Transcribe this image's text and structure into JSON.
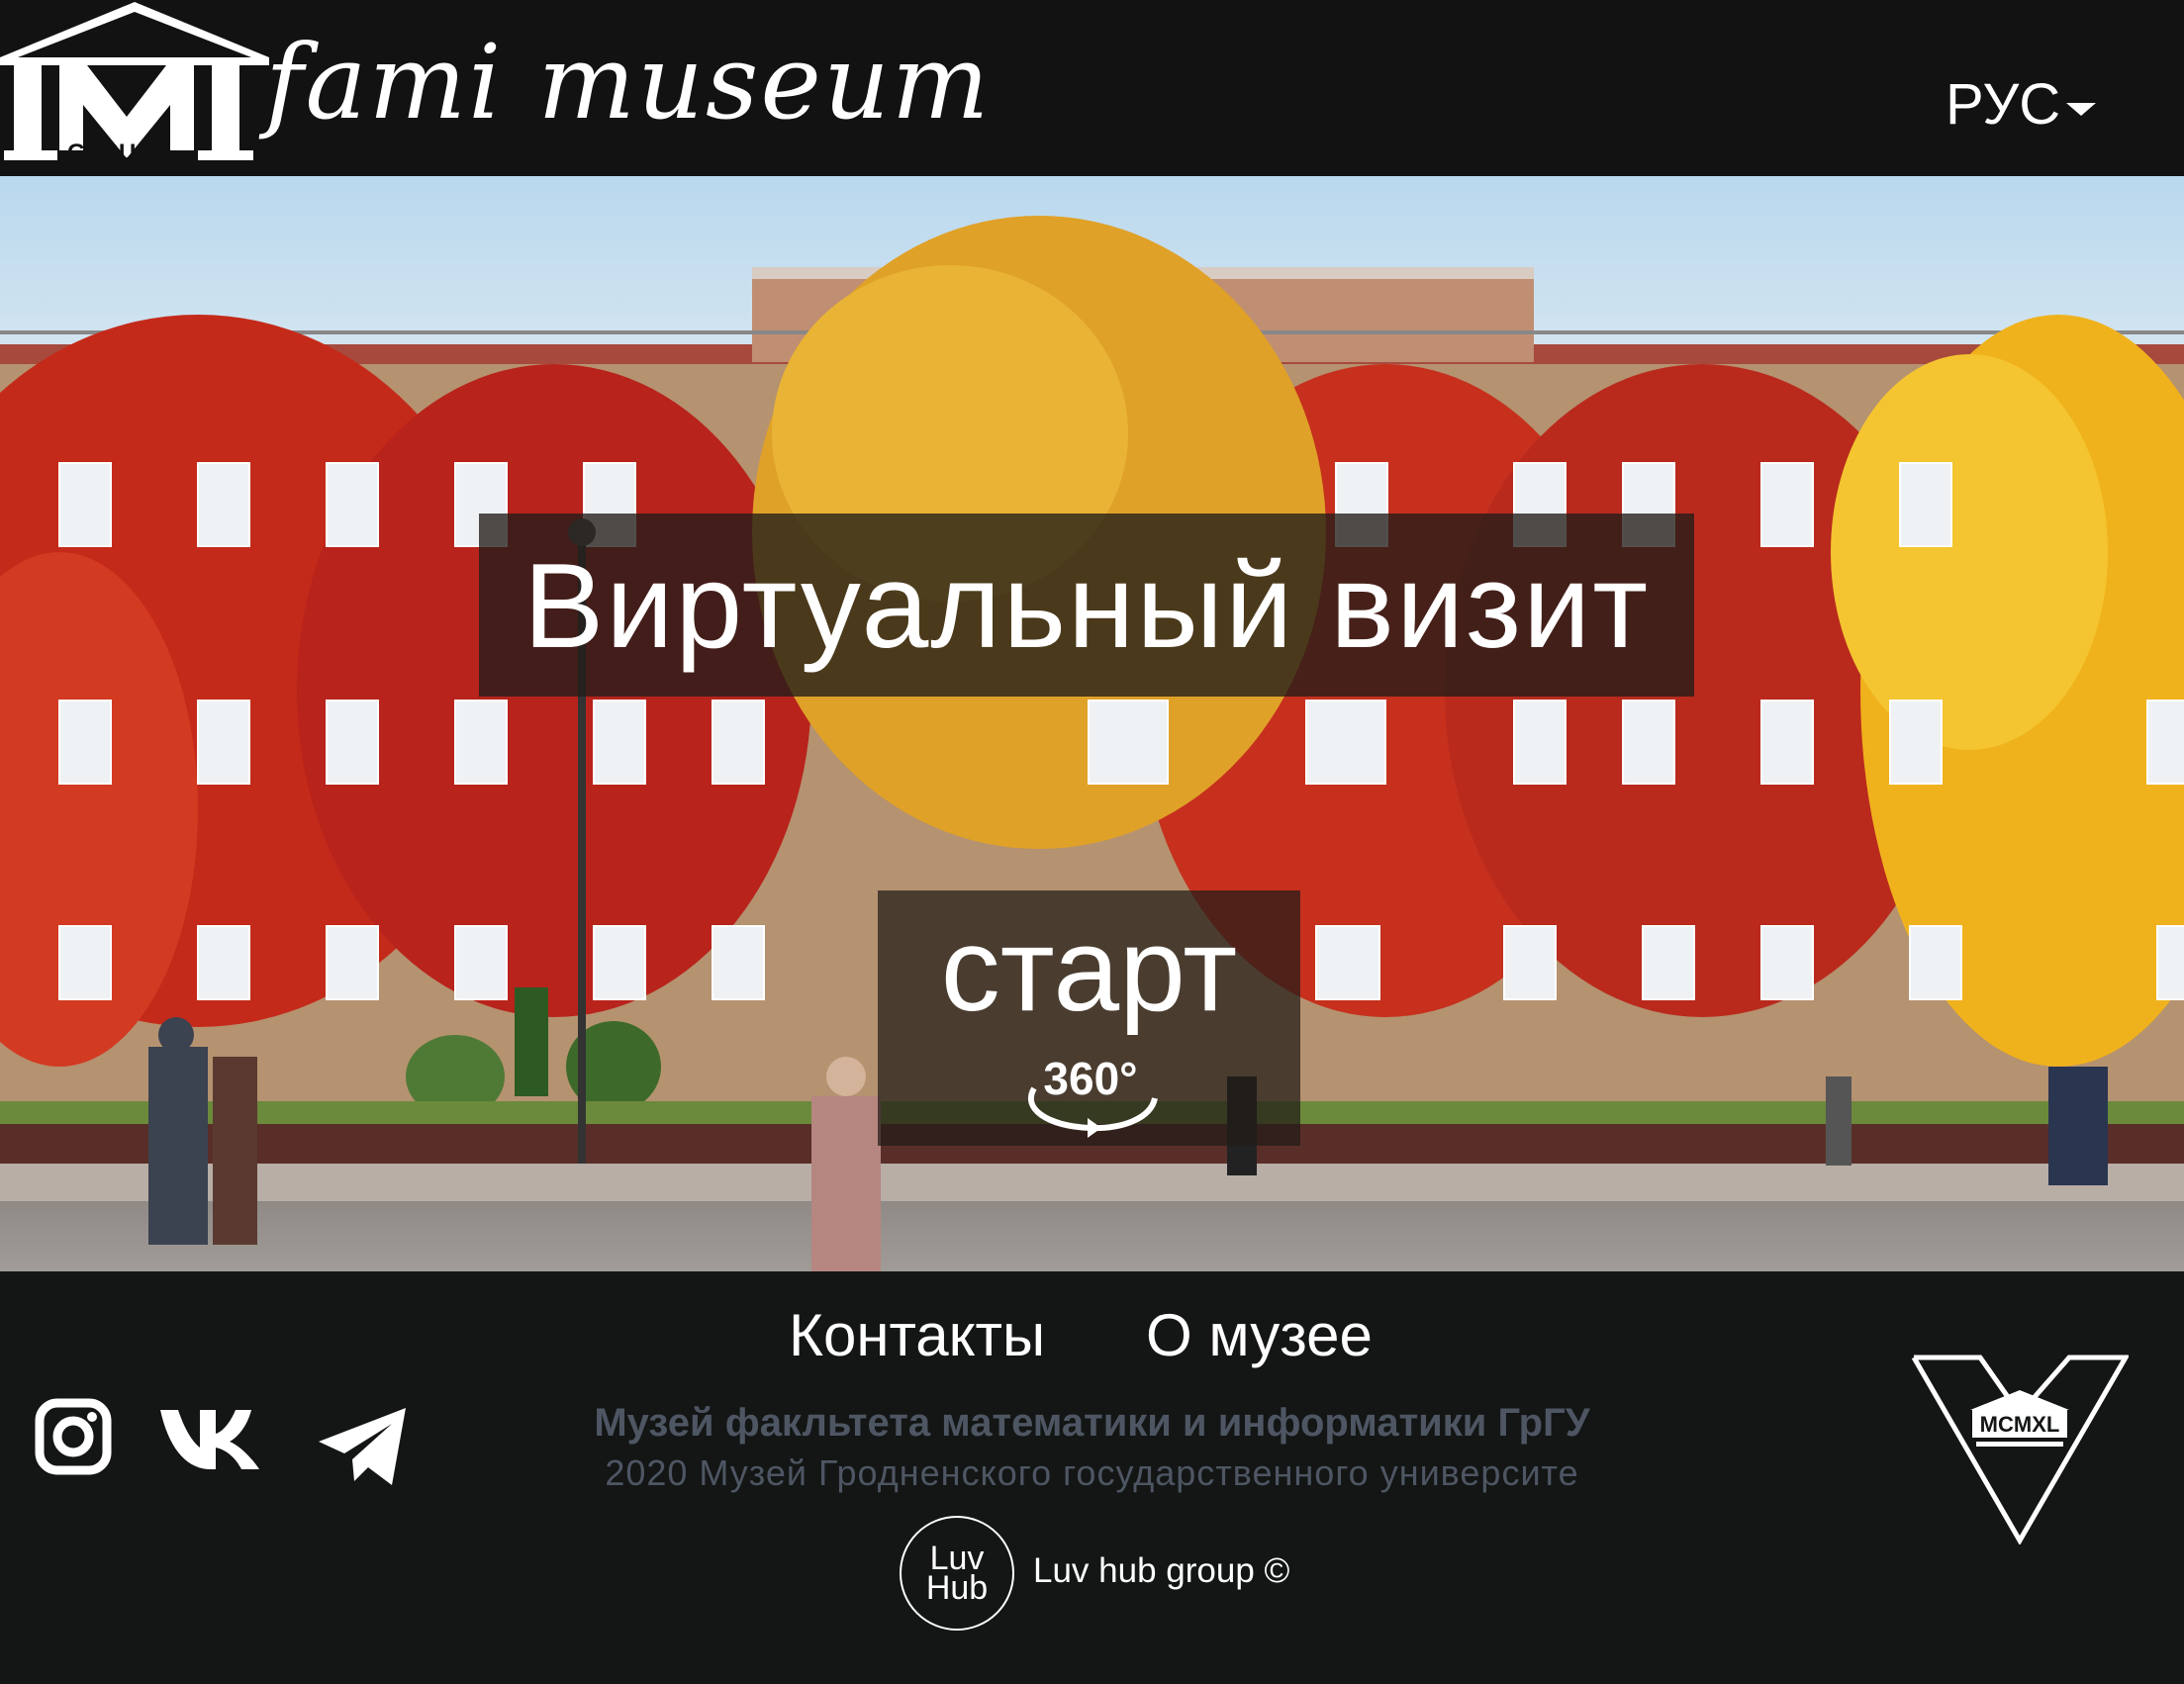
{
  "header": {
    "logo_badge_text": "GRSU",
    "logo_title": "fami museum",
    "language": "РУС"
  },
  "hero": {
    "title": "Виртуальный визит",
    "start_label": "старт",
    "badge_360": "360°"
  },
  "footer": {
    "nav": [
      {
        "label": "Контакты"
      },
      {
        "label": "О музее"
      }
    ],
    "social_icons": [
      "instagram-icon",
      "vk-icon",
      "telegram-icon"
    ],
    "museum_name": "Музей факльтета математики и информатики ГрГУ",
    "copyright": "2020 Музей Гродненского государственного университе",
    "dev_logo": [
      "Luv",
      "Hub"
    ],
    "dev_credit": "Luv hub group ©",
    "emblem_text": "MCMXL"
  },
  "colors": {
    "header_bg": "#121212",
    "footer_bg": "#131615",
    "muted_text": "#4e5663",
    "overlay": "#211c18"
  }
}
